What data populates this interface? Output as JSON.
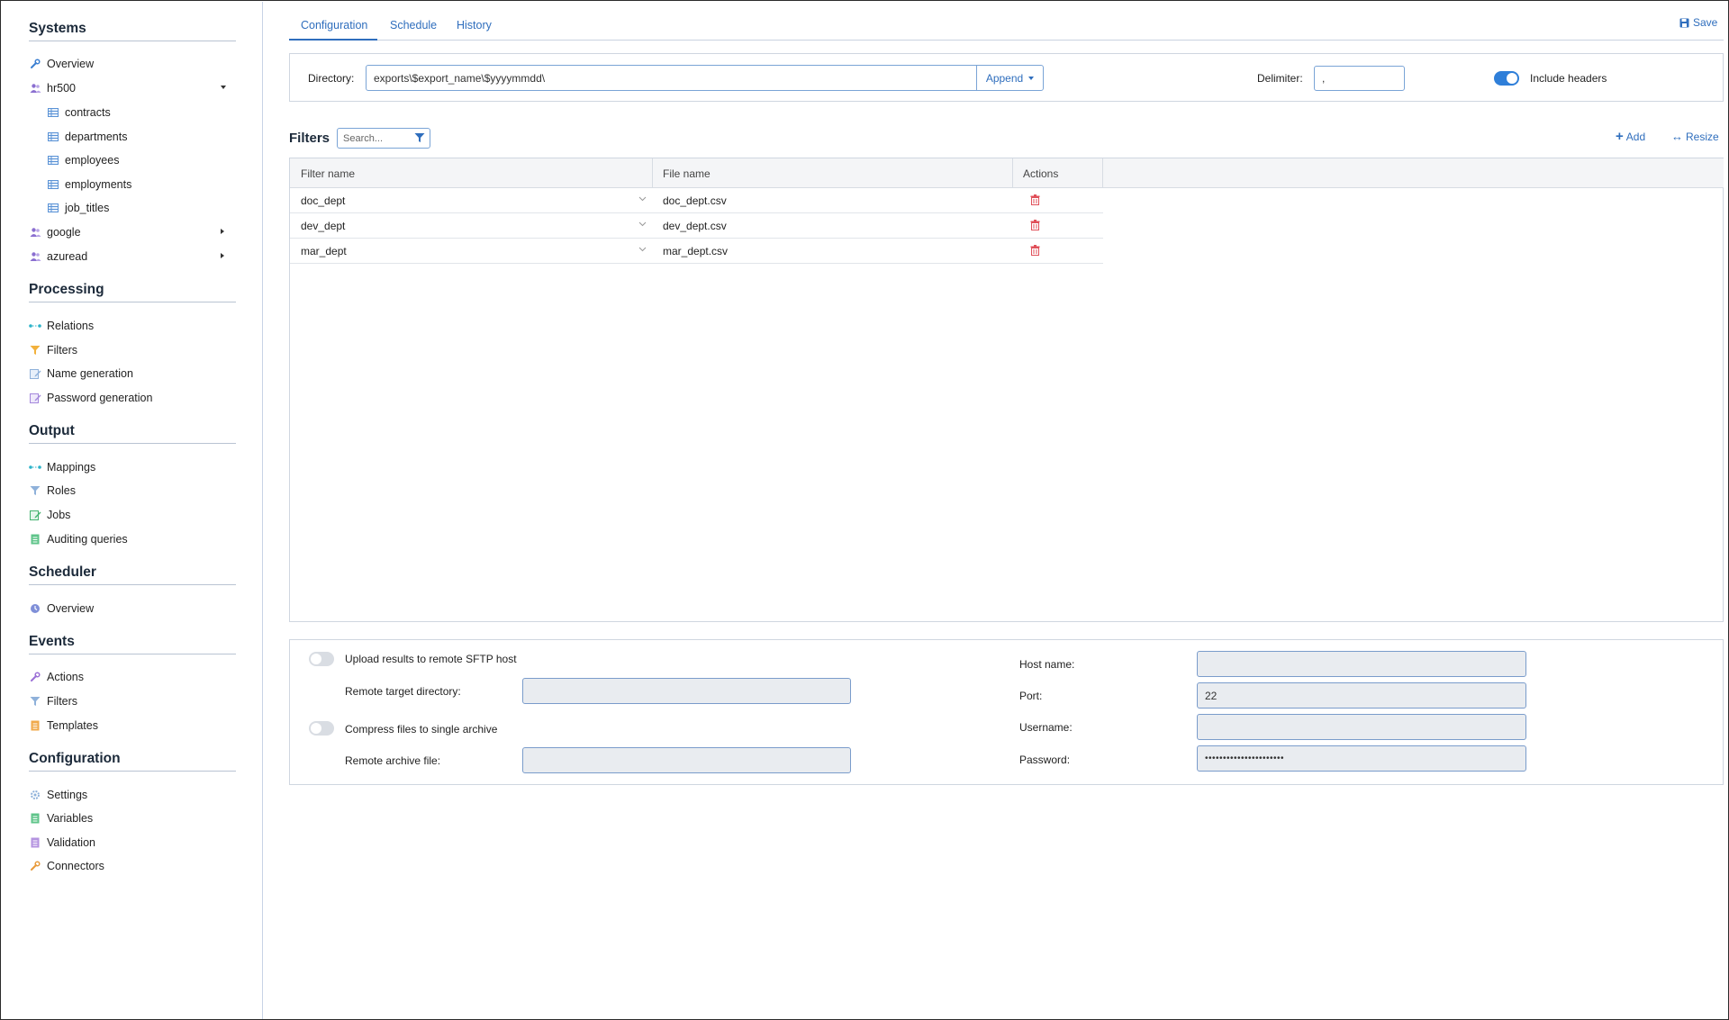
{
  "sidebar": {
    "systems": {
      "title": "Systems",
      "overview": "Overview",
      "hr500": "hr500",
      "hr500_items": [
        "contracts",
        "departments",
        "employees",
        "employments",
        "job_titles"
      ],
      "google": "google",
      "azuread": "azuread"
    },
    "processing": {
      "title": "Processing",
      "items": [
        "Relations",
        "Filters",
        "Name generation",
        "Password generation"
      ]
    },
    "output": {
      "title": "Output",
      "items": [
        "Mappings",
        "Roles",
        "Jobs",
        "Auditing queries"
      ]
    },
    "scheduler": {
      "title": "Scheduler",
      "items": [
        "Overview"
      ]
    },
    "events": {
      "title": "Events",
      "items": [
        "Actions",
        "Filters",
        "Templates"
      ]
    },
    "configuration": {
      "title": "Configuration",
      "items": [
        "Settings",
        "Variables",
        "Validation",
        "Connectors"
      ]
    }
  },
  "tabs": [
    "Configuration",
    "Schedule",
    "History"
  ],
  "save_label": "Save",
  "export": {
    "directory_label": "Directory:",
    "directory_value": "exports\\$export_name\\$yyyymmdd\\",
    "append_label": "Append",
    "delimiter_label": "Delimiter:",
    "delimiter_value": ",",
    "include_headers_label": "Include headers"
  },
  "filters": {
    "title": "Filters",
    "search_placeholder": "Search...",
    "add_label": "Add",
    "resize_label": "Resize",
    "columns": [
      "Filter name",
      "File name",
      "Actions"
    ],
    "rows": [
      {
        "filter": "doc_dept",
        "file": "doc_dept.csv"
      },
      {
        "filter": "dev_dept",
        "file": "dev_dept.csv"
      },
      {
        "filter": "mar_dept",
        "file": "mar_dept.csv"
      }
    ]
  },
  "sftp": {
    "upload_label": "Upload results to remote SFTP host",
    "remote_dir_label": "Remote target directory:",
    "compress_label": "Compress files to single archive",
    "archive_label": "Remote archive file:",
    "host_label": "Host name:",
    "port_label": "Port:",
    "port_value": "22",
    "username_label": "Username:",
    "password_label": "Password:",
    "password_value": "••••••••••••••••••••••"
  },
  "colors": {
    "accent": "#2f6ebd",
    "delete": "#e0505a"
  }
}
